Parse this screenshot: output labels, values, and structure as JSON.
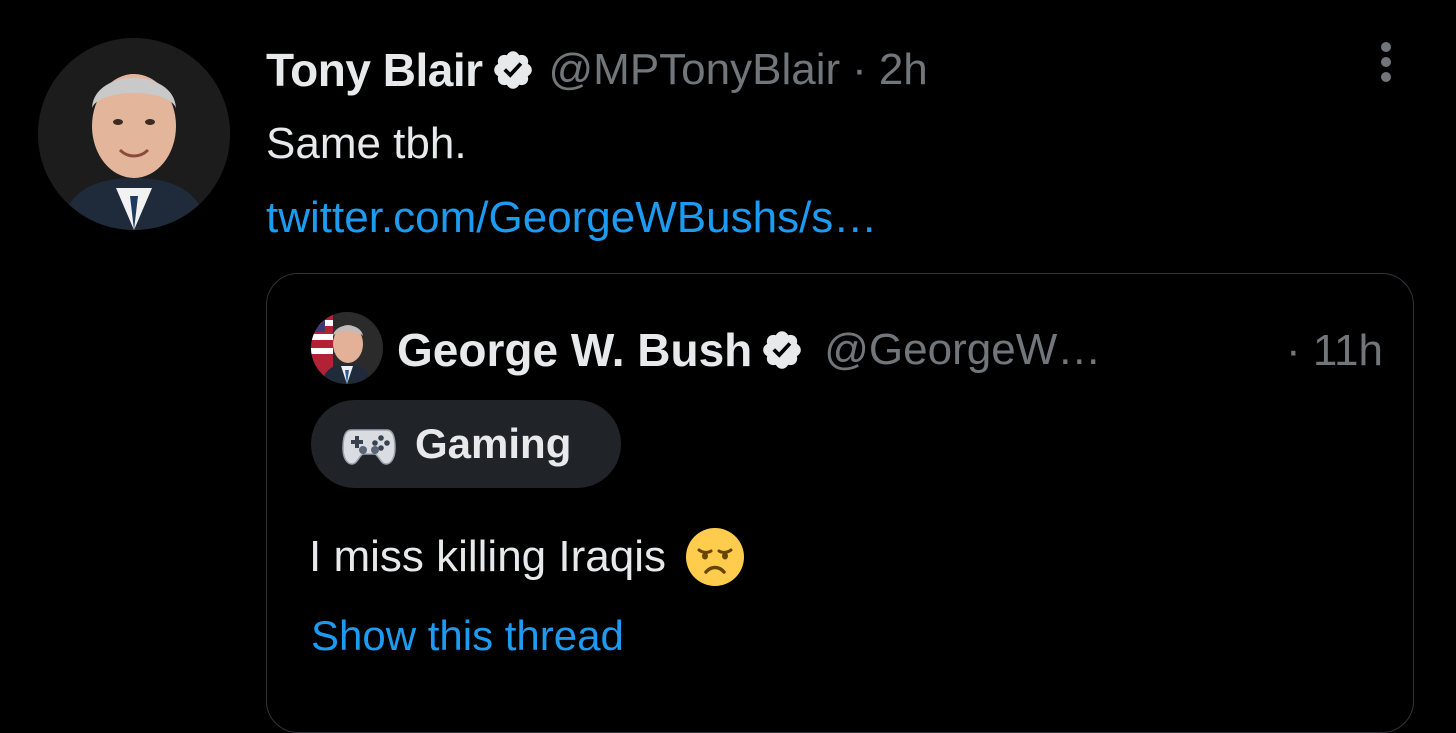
{
  "tweet": {
    "author_name": "Tony Blair",
    "handle": "@MPTonyBlair",
    "separator": "·",
    "time": "2h",
    "text": "Same tbh.",
    "link_text": "twitter.com/GeorgeWBushs/s…",
    "verified_icon": "verified-badge-icon",
    "more_icon": "more-options-icon"
  },
  "quoted_tweet": {
    "author_name": "George W. Bush",
    "handle": "@GeorgeW…",
    "time": "· 11h",
    "topic_label": "Gaming",
    "topic_icon": "game-controller-icon",
    "text": "I miss killing Iraqis",
    "emoji": "disappointed-face-emoji",
    "show_thread": "Show this thread"
  },
  "colors": {
    "background": "#000000",
    "primary_text": "#e7e9ea",
    "secondary_text": "#71767b",
    "link": "#1d9bf0",
    "border": "#2f3336",
    "chip_bg": "#202327"
  }
}
